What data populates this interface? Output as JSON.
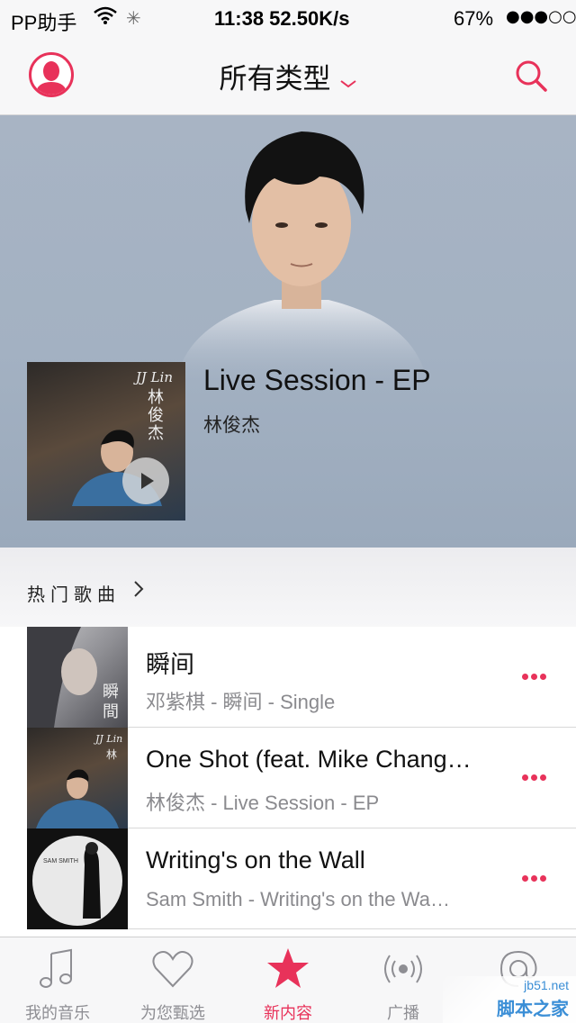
{
  "status_bar": {
    "carrier": "PP助手",
    "time": "11:38 52.50K/s",
    "battery_percent": "67%",
    "battery_dots": "●●●○○"
  },
  "nav": {
    "title": "所有类型",
    "accent_color": "#e8325a",
    "left_icon": "profile-icon",
    "right_icon": "search-icon"
  },
  "featured": {
    "album_title": "Live Session - EP",
    "artist": "林俊杰",
    "cover_text_en": "JJ Lin",
    "cover_text_cn": "林俊杰"
  },
  "hot_songs": {
    "header": "热门歌曲",
    "items": [
      {
        "title": "瞬间",
        "subtitle": "邓紫棋 - 瞬间 - Single"
      },
      {
        "title": "One Shot (feat. Mike Chang…",
        "subtitle": "林俊杰 - Live Session - EP"
      },
      {
        "title": "Writing's on the Wall",
        "subtitle": "Sam Smith - Writing's on the Wa…"
      }
    ]
  },
  "tab_bar": {
    "tabs": [
      {
        "label": "我的音乐",
        "icon": "music-note-icon",
        "active": false
      },
      {
        "label": "为您甄选",
        "icon": "heart-icon",
        "active": false
      },
      {
        "label": "新内容",
        "icon": "star-icon",
        "active": true
      },
      {
        "label": "广播",
        "icon": "radio-icon",
        "active": false
      },
      {
        "label": "",
        "icon": "connect-icon",
        "active": false
      }
    ]
  },
  "watermark": {
    "line1": "jb51.net",
    "line2": "脚本之家"
  }
}
